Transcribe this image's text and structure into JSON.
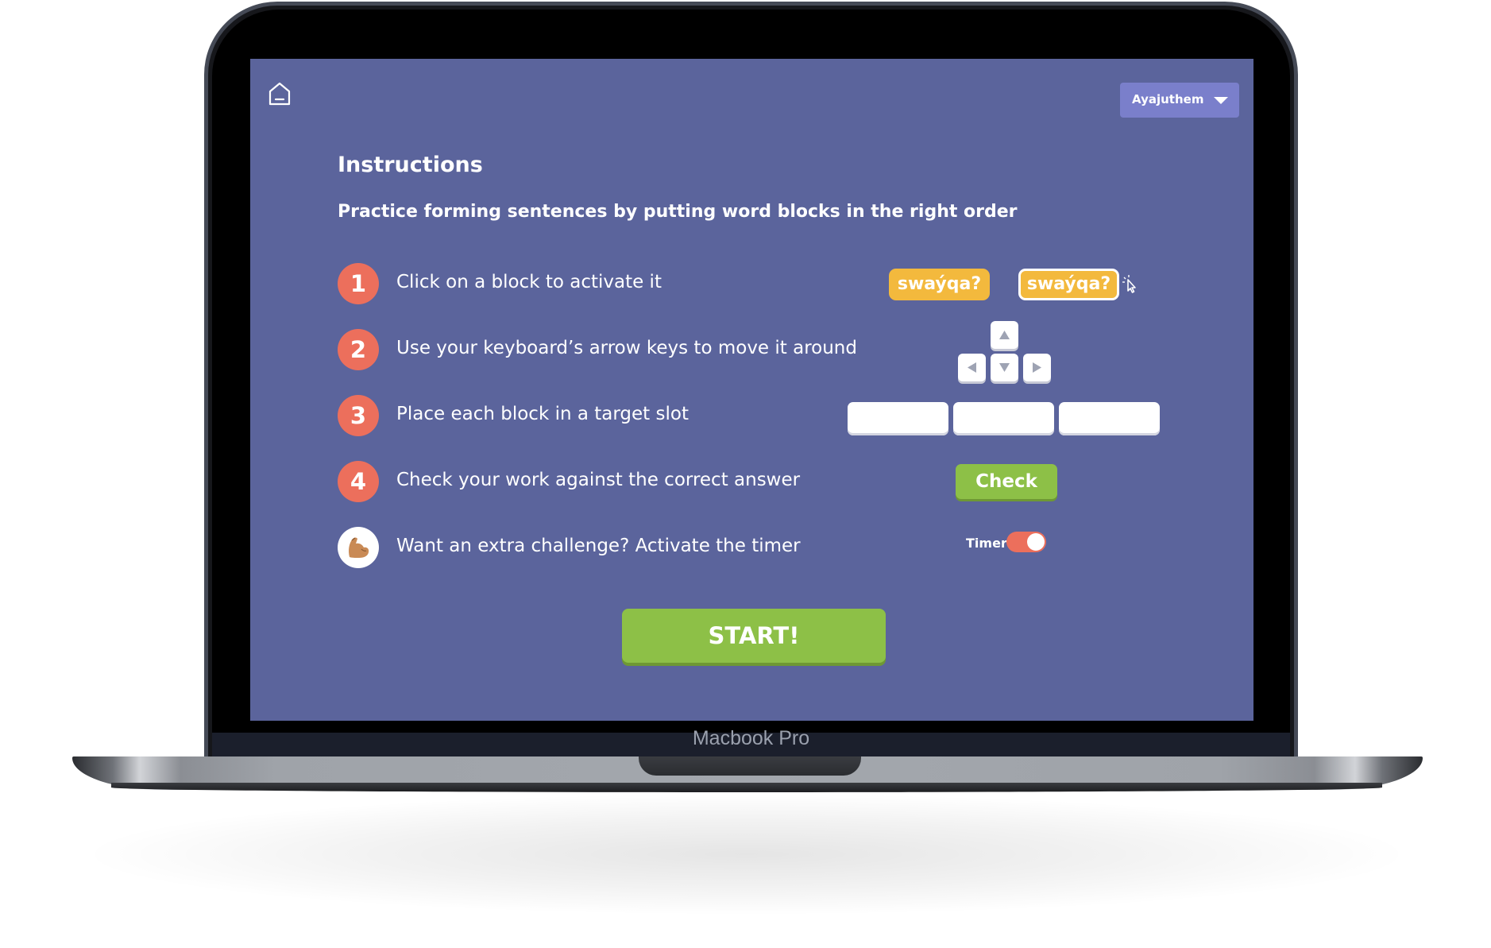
{
  "device": {
    "model_label": "Macbook Pro"
  },
  "header": {
    "home_icon": "home-icon",
    "user_dropdown": {
      "name": "Ayajuthem",
      "icon": "chevron-down-icon"
    }
  },
  "instructions": {
    "title": "Instructions",
    "subtitle": "Practice forming sentences by putting word blocks in the right order",
    "steps": [
      {
        "badge": "1",
        "text": "Click on a block to activate it"
      },
      {
        "badge": "2",
        "text": "Use your keyboard’s arrow keys to move it around"
      },
      {
        "badge": "3",
        "text": "Place each block in a target slot"
      },
      {
        "badge": "4",
        "text": "Check your work against the correct answer"
      },
      {
        "badge_icon": "flexed-biceps-icon",
        "text": "Want an extra challenge? Activate the timer"
      }
    ]
  },
  "demo": {
    "word_block": "swaýqa?",
    "word_block_active": "swaýqa?",
    "arrow_keys": [
      "up",
      "left",
      "down",
      "right"
    ],
    "check_label": "Check",
    "timer_label": "Timer",
    "timer_on": true
  },
  "start_label": "START!",
  "colors": {
    "screen_bg": "#5b649c",
    "badge": "#ec6f5c",
    "word_block": "#f3b93d",
    "green_button": "#8dc047",
    "dropdown": "#7a7fcb"
  }
}
